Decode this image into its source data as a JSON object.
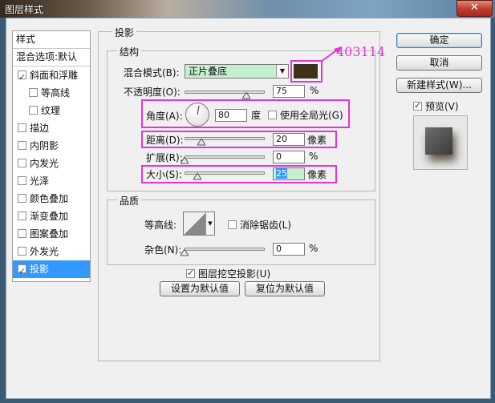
{
  "window": {
    "title": "图层样式",
    "close_label": "✕"
  },
  "left_panel": {
    "header": "样式",
    "blend_options": "混合选项:默认",
    "items": [
      {
        "label": "斜面和浮雕",
        "checked": true,
        "sub": false,
        "selected": false
      },
      {
        "label": "等高线",
        "checked": false,
        "sub": true,
        "selected": false
      },
      {
        "label": "纹理",
        "checked": false,
        "sub": true,
        "selected": false
      },
      {
        "label": "描边",
        "checked": false,
        "sub": false,
        "selected": false
      },
      {
        "label": "内阴影",
        "checked": false,
        "sub": false,
        "selected": false
      },
      {
        "label": "内发光",
        "checked": false,
        "sub": false,
        "selected": false
      },
      {
        "label": "光泽",
        "checked": false,
        "sub": false,
        "selected": false
      },
      {
        "label": "颜色叠加",
        "checked": false,
        "sub": false,
        "selected": false
      },
      {
        "label": "渐变叠加",
        "checked": false,
        "sub": false,
        "selected": false
      },
      {
        "label": "图案叠加",
        "checked": false,
        "sub": false,
        "selected": false
      },
      {
        "label": "外发光",
        "checked": false,
        "sub": false,
        "selected": false
      },
      {
        "label": "投影",
        "checked": true,
        "sub": false,
        "selected": true
      }
    ]
  },
  "drop_shadow": {
    "section_title": "投影",
    "structure": {
      "title": "结构",
      "blend_mode_label": "混合模式(B):",
      "blend_mode_value": "正片叠底",
      "shadow_color": "#403114",
      "color_annotation": "403114",
      "opacity_label": "不透明度(O):",
      "opacity_value": "75",
      "opacity_unit": "%",
      "angle_label": "角度(A):",
      "angle_value": "80",
      "angle_unit": "度",
      "global_light_label": "使用全局光(G)",
      "global_light_checked": false,
      "distance_label": "距离(D):",
      "distance_value": "20",
      "distance_unit": "像素",
      "spread_label": "扩展(R):",
      "spread_value": "0",
      "spread_unit": "%",
      "size_label": "大小(S):",
      "size_value": "25",
      "size_unit": "像素"
    },
    "quality": {
      "title": "品质",
      "contour_label": "等高线:",
      "anti_alias_label": "消除锯齿(L)",
      "anti_alias_checked": false,
      "noise_label": "杂色(N):",
      "noise_value": "0",
      "noise_unit": "%"
    },
    "knockout_label": "图层挖空投影(U)",
    "knockout_checked": true,
    "make_default_label": "设置为默认值",
    "reset_default_label": "复位为默认值"
  },
  "right": {
    "ok_label": "确定",
    "cancel_label": "取消",
    "new_style_label": "新建样式(W)...",
    "preview_label": "预览(V)",
    "preview_checked": true
  },
  "colors": {
    "accent": "#3399ff",
    "annotation": "#e633d9",
    "select_bg": "#c6efce"
  }
}
